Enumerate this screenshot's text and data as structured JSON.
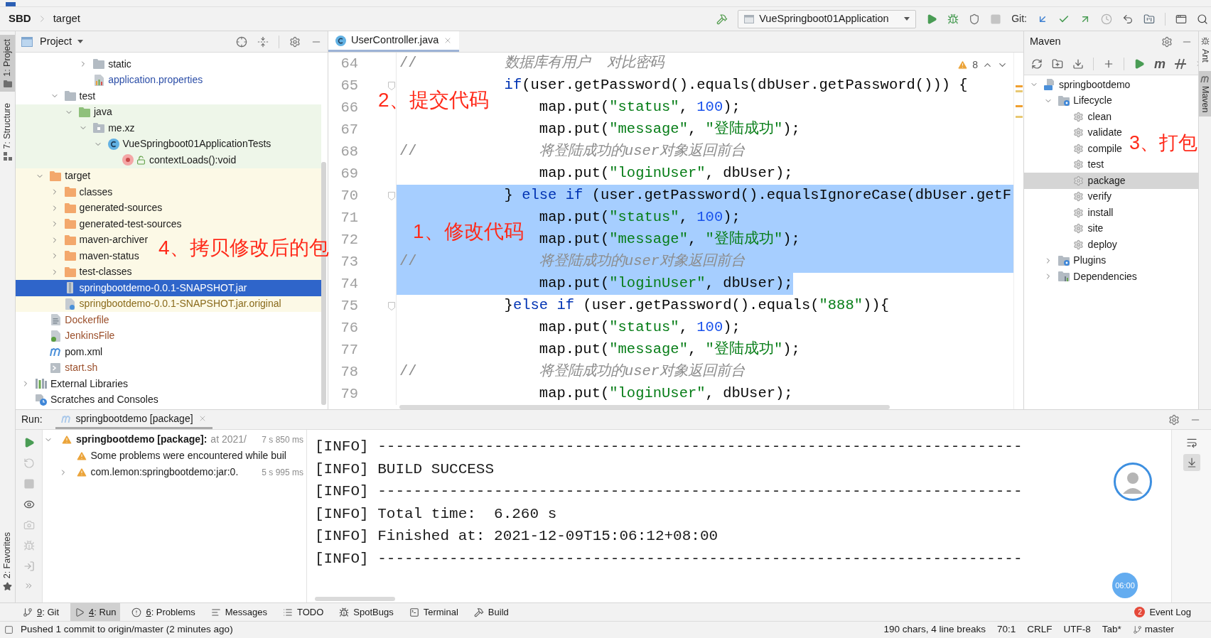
{
  "toolbar": {
    "breadcrumbs": [
      {
        "label": "SBD",
        "kind": "project"
      },
      {
        "label": "target",
        "kind": "folder"
      }
    ],
    "run_config": "VueSpringboot01Application",
    "git_label": "Git:"
  },
  "left_stripe": {
    "top": [
      {
        "label": "1: Project",
        "kind": "project",
        "selected": true
      },
      {
        "label": "7: Structure",
        "kind": "structure",
        "selected": false
      }
    ],
    "bottom": [
      {
        "label": "2: Favorites",
        "kind": "favorites",
        "selected": false
      }
    ]
  },
  "project_panel": {
    "title": "Project",
    "focused": true,
    "tree": [
      {
        "children": [
          {
            "children": [
              {
                "children": [
                  {
                    "children": [
                      {
                        "label": "static",
                        "kind": "folder",
                        "expanded": false,
                        "selected": false
                      },
                      {
                        "label": "application.properties",
                        "kind": "properties",
                        "modified": true,
                        "selected": false
                      }
                    ]
                  }
                ]
              },
              {
                "label": "test",
                "kind": "folder",
                "expanded": true,
                "selected": false,
                "children": [
                  {
                    "label": "java",
                    "kind": "test-root",
                    "test_source": true,
                    "expanded": true,
                    "selected": false,
                    "children": [
                      {
                        "label": "me.xz",
                        "kind": "package",
                        "test_source": true,
                        "expanded": true,
                        "selected": false,
                        "children": [
                          {
                            "label": "VueSpringboot01ApplicationTests",
                            "kind": "class",
                            "test_source": true,
                            "expanded": true,
                            "selected": false,
                            "children": [
                              {
                                "label": "contextLoads():void",
                                "kind": "method",
                                "test_source": true,
                                "selected": false
                              }
                            ]
                          }
                        ]
                      }
                    ]
                  }
                ]
              }
            ]
          },
          {
            "label": "target",
            "kind": "excluded-folder",
            "excluded": true,
            "expanded": true,
            "selected": false,
            "children": [
              {
                "label": "classes",
                "kind": "excluded-folder",
                "excluded": true,
                "expanded": false,
                "selected": false
              },
              {
                "label": "generated-sources",
                "kind": "excluded-folder",
                "excluded": true,
                "expanded": false,
                "selected": false
              },
              {
                "label": "generated-test-sources",
                "kind": "excluded-folder",
                "excluded": true,
                "expanded": false,
                "selected": false
              },
              {
                "label": "maven-archiver",
                "kind": "excluded-folder",
                "excluded": true,
                "expanded": false,
                "selected": false
              },
              {
                "label": "maven-status",
                "kind": "excluded-folder",
                "excluded": true,
                "expanded": false,
                "selected": false
              },
              {
                "label": "test-classes",
                "kind": "excluded-folder",
                "excluded": true,
                "expanded": false,
                "selected": false
              },
              {
                "label": "springbootdemo-0.0.1-SNAPSHOT.jar",
                "kind": "jar",
                "excluded": true,
                "ignored": true,
                "selected": true
              },
              {
                "label": "springbootdemo-0.0.1-SNAPSHOT.jar.original",
                "kind": "unknown-file",
                "excluded": true,
                "ignored": true,
                "selected": false
              }
            ]
          },
          {
            "label": "Dockerfile",
            "kind": "text-file",
            "unversioned": true,
            "selected": false
          },
          {
            "label": "JenkinsFile",
            "kind": "script-file",
            "unversioned": true,
            "selected": false
          },
          {
            "label": "pom.xml",
            "kind": "maven",
            "selected": false
          },
          {
            "label": "start.sh",
            "kind": "shell",
            "unversioned": true,
            "selected": false
          }
        ]
      },
      {
        "label": "External Libraries",
        "kind": "libraries",
        "expanded": false,
        "selected": false
      },
      {
        "label": "Scratches and Consoles",
        "kind": "scratches",
        "selected": false
      }
    ]
  },
  "editor": {
    "tabs": [
      {
        "label": "UserController.java",
        "selected": true
      }
    ],
    "warning_count": "8",
    "lines": [
      {
        "number": "64",
        "kind": "statement",
        "selected": false,
        "fold": false,
        "tokens": [
          {
            "kind": "comment-mark",
            "text": "//"
          },
          {
            "kind": "comment",
            "text": "数据库有用户  对比密码"
          }
        ]
      },
      {
        "number": "65",
        "kind": "statement",
        "selected": false,
        "fold": true,
        "tokens": [
          {
            "kind": "keyword",
            "text": "if"
          },
          {
            "kind": "plain",
            "text": "(user.getPassword().equals(dbUser.getPassword())) {"
          }
        ]
      },
      {
        "number": "66",
        "kind": "body",
        "selected": false,
        "fold": false,
        "tokens": [
          {
            "kind": "plain",
            "text": "map.put("
          },
          {
            "kind": "string",
            "text": "\"status\""
          },
          {
            "kind": "plain",
            "text": ", "
          },
          {
            "kind": "number",
            "text": "100"
          },
          {
            "kind": "plain",
            "text": ");"
          }
        ]
      },
      {
        "number": "67",
        "kind": "body",
        "selected": false,
        "fold": false,
        "tokens": [
          {
            "kind": "plain",
            "text": "map.put("
          },
          {
            "kind": "string",
            "text": "\"message\""
          },
          {
            "kind": "plain",
            "text": ", "
          },
          {
            "kind": "string",
            "text": "\"登陆成功\""
          },
          {
            "kind": "plain",
            "text": ");"
          }
        ]
      },
      {
        "number": "68",
        "kind": "body",
        "selected": false,
        "fold": false,
        "tokens": [
          {
            "kind": "comment-mark",
            "text": "//"
          },
          {
            "kind": "comment",
            "text": "将登陆成功的user对象返回前台"
          }
        ]
      },
      {
        "number": "69",
        "kind": "body",
        "selected": false,
        "fold": false,
        "tokens": [
          {
            "kind": "plain",
            "text": "map.put("
          },
          {
            "kind": "string",
            "text": "\"loginUser\""
          },
          {
            "kind": "plain",
            "text": ", dbUser);"
          }
        ]
      },
      {
        "number": "70",
        "kind": "statement",
        "selected": true,
        "fold": true,
        "tokens": [
          {
            "kind": "plain",
            "text": "} "
          },
          {
            "kind": "keyword",
            "text": "else if"
          },
          {
            "kind": "plain",
            "text": " (user.getPassword().equalsIgnoreCase(dbUser.getF"
          }
        ]
      },
      {
        "number": "71",
        "kind": "body",
        "selected": true,
        "fold": false,
        "tokens": [
          {
            "kind": "plain",
            "text": "map.put("
          },
          {
            "kind": "string",
            "text": "\"status\""
          },
          {
            "kind": "plain",
            "text": ", "
          },
          {
            "kind": "number",
            "text": "100"
          },
          {
            "kind": "plain",
            "text": ");"
          }
        ]
      },
      {
        "number": "72",
        "kind": "body",
        "selected": true,
        "fold": false,
        "tokens": [
          {
            "kind": "plain",
            "text": "map.put("
          },
          {
            "kind": "string",
            "text": "\"message\""
          },
          {
            "kind": "plain",
            "text": ", "
          },
          {
            "kind": "string",
            "text": "\"登陆成功\""
          },
          {
            "kind": "plain",
            "text": ");"
          }
        ]
      },
      {
        "number": "73",
        "kind": "body",
        "selected": true,
        "fold": false,
        "tokens": [
          {
            "kind": "comment-mark",
            "text": "//"
          },
          {
            "kind": "comment",
            "text": "将登陆成功的user对象返回前台"
          }
        ]
      },
      {
        "number": "74",
        "kind": "body",
        "selected": true,
        "fold": false,
        "tokens": [
          {
            "kind": "plain",
            "text": "map.put("
          },
          {
            "kind": "string",
            "text": "\"loginUser\""
          },
          {
            "kind": "plain",
            "text": ", dbUser);"
          }
        ]
      },
      {
        "number": "75",
        "kind": "statement",
        "selected": false,
        "fold": true,
        "tokens": [
          {
            "kind": "plain",
            "text": "}"
          },
          {
            "kind": "keyword",
            "text": "else if"
          },
          {
            "kind": "plain",
            "text": " (user.getPassword().equals("
          },
          {
            "kind": "string",
            "text": "\"888\""
          },
          {
            "kind": "plain",
            "text": ")){"
          }
        ]
      },
      {
        "number": "76",
        "kind": "body",
        "selected": false,
        "fold": false,
        "tokens": [
          {
            "kind": "plain",
            "text": "map.put("
          },
          {
            "kind": "string",
            "text": "\"status\""
          },
          {
            "kind": "plain",
            "text": ", "
          },
          {
            "kind": "number",
            "text": "100"
          },
          {
            "kind": "plain",
            "text": ");"
          }
        ]
      },
      {
        "number": "77",
        "kind": "body",
        "selected": false,
        "fold": false,
        "tokens": [
          {
            "kind": "plain",
            "text": "map.put("
          },
          {
            "kind": "string",
            "text": "\"message\""
          },
          {
            "kind": "plain",
            "text": ", "
          },
          {
            "kind": "string",
            "text": "\"登陆成功\""
          },
          {
            "kind": "plain",
            "text": ");"
          }
        ]
      },
      {
        "number": "78",
        "kind": "body",
        "selected": false,
        "fold": false,
        "tokens": [
          {
            "kind": "comment-mark",
            "text": "//"
          },
          {
            "kind": "comment",
            "text": "将登陆成功的user对象返回前台"
          }
        ]
      },
      {
        "number": "79",
        "kind": "body",
        "selected": false,
        "fold": false,
        "tokens": [
          {
            "kind": "plain",
            "text": "map.put("
          },
          {
            "kind": "string",
            "text": "\"loginUser\""
          },
          {
            "kind": "plain",
            "text": ", dbUser);"
          }
        ]
      }
    ]
  },
  "maven_panel": {
    "title": "Maven",
    "goal_glyph": "m",
    "focused": false,
    "tree": [
      {
        "label": "springbootdemo",
        "kind": "maven-module",
        "expanded": true,
        "selected": false,
        "children": [
          {
            "label": "Lifecycle",
            "kind": "config-folder",
            "expanded": true,
            "selected": false,
            "children": [
              {
                "label": "clean",
                "kind": "goal",
                "selected": false
              },
              {
                "label": "validate",
                "kind": "goal",
                "selected": false
              },
              {
                "label": "compile",
                "kind": "goal",
                "selected": false
              },
              {
                "label": "test",
                "kind": "goal",
                "selected": false
              },
              {
                "label": "package",
                "kind": "goal",
                "selected": true
              },
              {
                "label": "verify",
                "kind": "goal",
                "selected": false
              },
              {
                "label": "install",
                "kind": "goal",
                "selected": false
              },
              {
                "label": "site",
                "kind": "goal",
                "selected": false
              },
              {
                "label": "deploy",
                "kind": "goal",
                "selected": false
              }
            ]
          },
          {
            "label": "Plugins",
            "kind": "config-folder",
            "expanded": false,
            "selected": false
          },
          {
            "label": "Dependencies",
            "kind": "libraries-folder",
            "expanded": false,
            "selected": false
          }
        ]
      }
    ]
  },
  "right_stripe": [
    {
      "label": "Ant",
      "kind": "ant",
      "selected": false
    },
    {
      "label": "Maven",
      "kind": "maven",
      "selected": true
    }
  ],
  "annotations": [
    "2、提交代码",
    "3、打包",
    "1、修改代码",
    "4、拷贝修改后的包"
  ],
  "run_panel": {
    "label": "Run:",
    "tabs": [
      {
        "label": "springbootdemo [package]",
        "selected": true
      }
    ],
    "tree": [
      {
        "name": "springbootdemo [package]:",
        "detail": "at 2021/",
        "time": "7 s 850 ms",
        "kind": "warning",
        "expanded": true,
        "selected": false,
        "children": [
          {
            "name": "Some problems were encountered while buil",
            "kind": "warning",
            "selected": false
          },
          {
            "name": "com.lemon:springbootdemo:jar:0.",
            "time": "5 s 995 ms",
            "kind": "warning",
            "expanded": false,
            "selected": false
          }
        ]
      }
    ],
    "console": [
      "[INFO] ------------------------------------------------------------------------",
      "[INFO] BUILD SUCCESS",
      "[INFO] ------------------------------------------------------------------------",
      "[INFO] Total time:  6.260 s",
      "[INFO] Finished at: 2021-12-09T15:06:12+08:00",
      "[INFO] ------------------------------------------------------------------------"
    ],
    "recording_timer": "06:00"
  },
  "tool_windows": {
    "left": [
      {
        "mnemonic": "9",
        "label": ": Git",
        "kind": "git",
        "selected": false
      },
      {
        "mnemonic": "4",
        "label": ": Run",
        "kind": "run",
        "selected": true
      },
      {
        "mnemonic": "6",
        "label": ": Problems",
        "kind": "problems",
        "selected": false
      },
      {
        "label": "Messages",
        "kind": "messages",
        "selected": false
      },
      {
        "label": "TODO",
        "kind": "todo",
        "selected": false
      },
      {
        "label": "SpotBugs",
        "kind": "spotbugs",
        "selected": false
      },
      {
        "label": "Terminal",
        "kind": "terminal",
        "selected": false
      },
      {
        "label": "Build",
        "kind": "build",
        "selected": false
      }
    ],
    "right": [
      {
        "label": "Event Log",
        "badge": "2"
      }
    ]
  },
  "status_bar": {
    "message": "Pushed 1 commit to origin/master (2 minutes ago)",
    "items": [
      "190 chars, 4 line breaks",
      "70:1",
      "CRLF",
      "UTF-8",
      "Tab*"
    ],
    "branch": "master"
  }
}
